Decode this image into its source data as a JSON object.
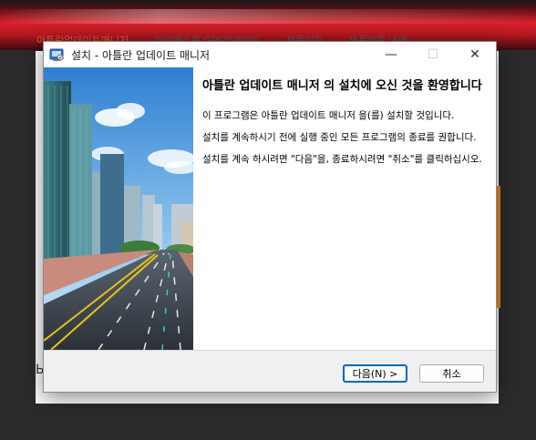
{
  "background": {
    "nav_items": [
      "아틀란업데이트매니저",
      "하이패스용 GPS업데이트",
      "제품인증",
      "제품인증 내역"
    ],
    "bottom_text": "Ь"
  },
  "window": {
    "title": "설치 - 아틀란 업데이트 매니저",
    "minimize_glyph": "—",
    "maximize_glyph": "☐",
    "close_glyph": "✕"
  },
  "content": {
    "title": "아틀란 업데이트 매니저 의 설치에 오신 것을 환영합니다",
    "paragraphs": [
      "이 프로그램은 아틀란 업데이트 매니저 을(를) 설치할 것입니다.",
      "설치를 계속하시기 전에 실행 중인 모든 프로그램의 종료를 권합니다.",
      "설치를 계속 하시려면 \"다음\"을, 종료하시려면 \"취소\"를 클릭하십시오."
    ]
  },
  "buttons": {
    "next_label": "다음(N) >",
    "cancel_label": "취소"
  },
  "icons": {
    "app": "installer-icon",
    "minimize": "minimize-icon",
    "maximize": "maximize-icon",
    "close": "close-icon"
  },
  "colors": {
    "accent": "#0067c0",
    "banner_red": "#d8202a",
    "orange": "#e08a23"
  }
}
